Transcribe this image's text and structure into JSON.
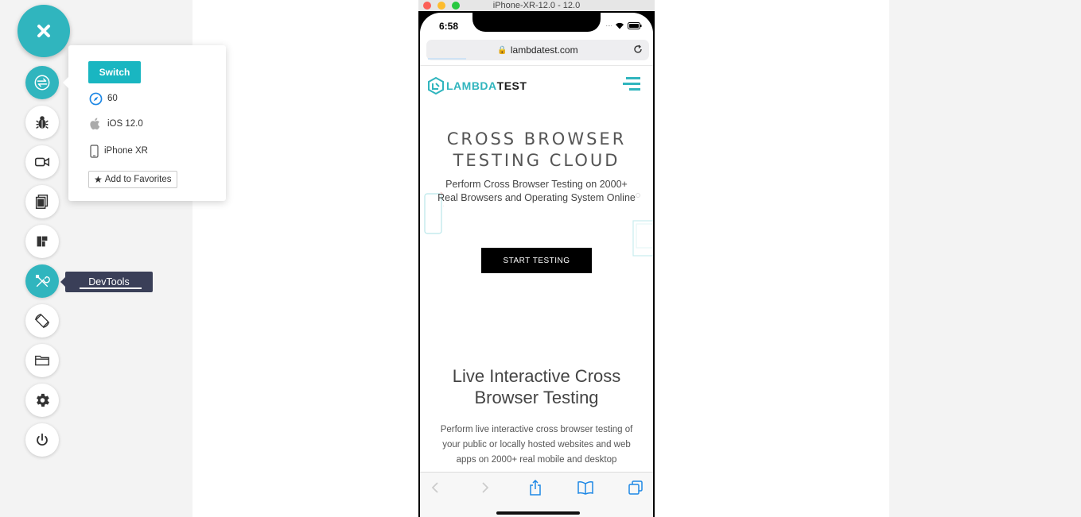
{
  "toolbar": {
    "close_icon": "close-icon",
    "items": [
      {
        "name": "switch",
        "icon": "switch-icon",
        "active": true
      },
      {
        "name": "bug",
        "icon": "bug-icon",
        "active": false
      },
      {
        "name": "video",
        "icon": "video-camera-icon",
        "active": false
      },
      {
        "name": "screenshot",
        "icon": "screenshot-icon",
        "active": false
      },
      {
        "name": "resolution",
        "icon": "layout-icon",
        "active": false
      },
      {
        "name": "devtools",
        "icon": "tools-icon",
        "active": true
      },
      {
        "name": "rotate",
        "icon": "rotate-icon",
        "active": false
      },
      {
        "name": "folder",
        "icon": "folder-icon",
        "active": false
      },
      {
        "name": "settings",
        "icon": "gear-icon",
        "active": false
      },
      {
        "name": "power",
        "icon": "power-icon",
        "active": false
      }
    ]
  },
  "popover": {
    "switch_label": "Switch",
    "browser_version": "60",
    "os": "iOS 12.0",
    "device": "iPhone XR",
    "favorites_label": "Add to Favorites"
  },
  "tooltip": {
    "label": "DevTools"
  },
  "simulator": {
    "title": "iPhone-XR-12.0 - 12.0",
    "status_time": "6:58",
    "url": "lambdatest.com",
    "site": {
      "logo_prefix": "LAMBDA",
      "logo_suffix": "TEST",
      "hero_title": "CROSS BROWSER TESTING CLOUD",
      "hero_subtitle": "Perform Cross Browser Testing on 2000+ Real Browsers and Operating System Online",
      "cta_label": "START TESTING",
      "section_title": "Live Interactive Cross Browser Testing",
      "section_body": "Perform live interactive cross browser testing of your public or locally hosted websites and web apps on 2000+ real mobile and desktop"
    }
  },
  "colors": {
    "accent": "#30b5be",
    "switch_button": "#19b6c1",
    "tooltip_bg": "#3a3f58"
  }
}
